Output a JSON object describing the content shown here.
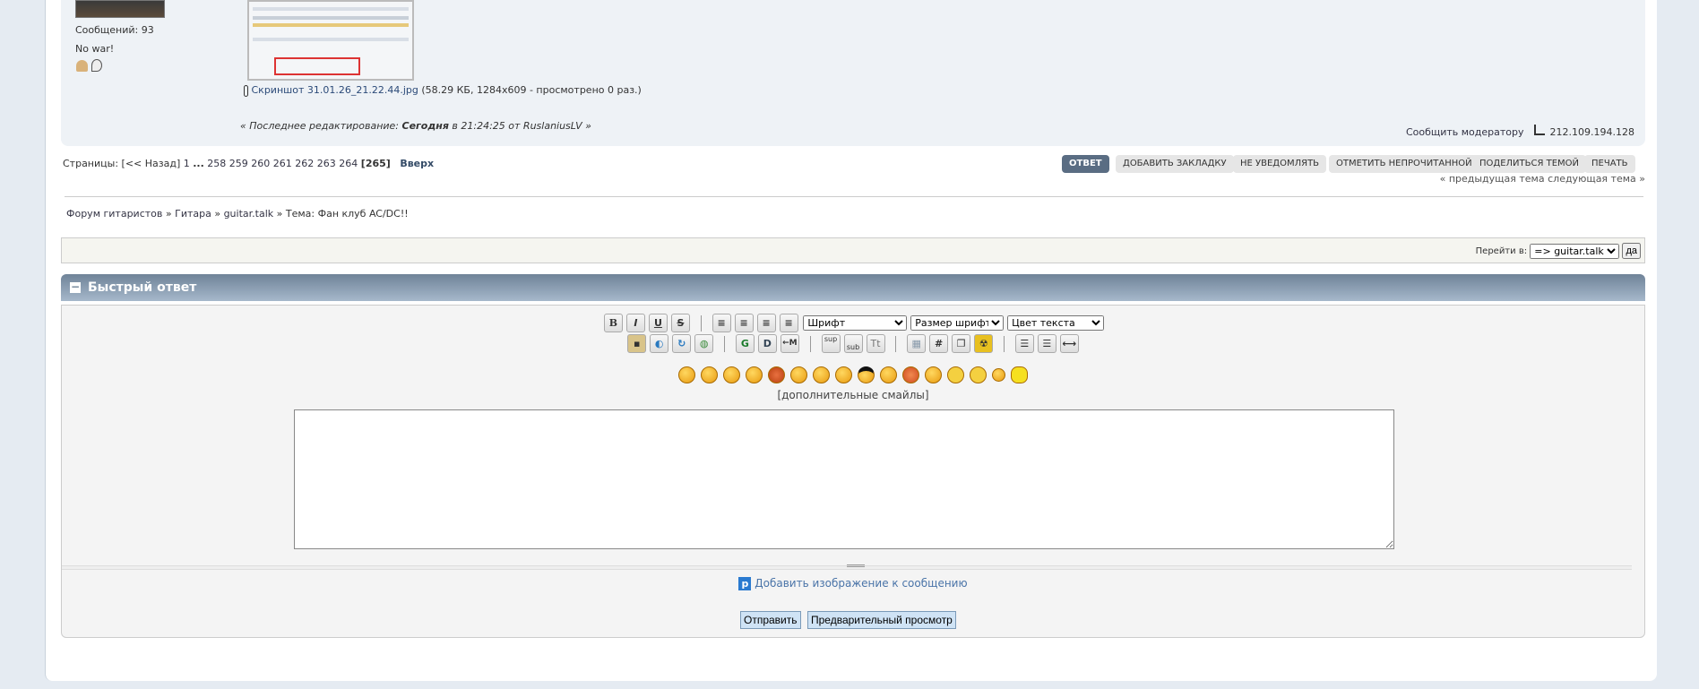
{
  "post": {
    "posts_count": "Сообщений: 93",
    "signature": "No war!",
    "attachment_name": "Скриншот 31.01.26_21.22.44.jpg",
    "attachment_info": "(58.29 КБ, 1284x609 - просмотрено 0 раз.)",
    "edit_prefix": "« Последнее редактирование:",
    "edit_day": "Сегодня",
    "edit_suffix": "в 21:24:25 от RuslaniusLV »",
    "report": "Сообщить модератору",
    "ip": "212.109.194.128"
  },
  "pagination": {
    "label": "Страницы: [<< Назад]",
    "first": "1",
    "dots": "...",
    "pages": [
      "258",
      "259",
      "260",
      "261",
      "262",
      "263",
      "264"
    ],
    "current": "[265]",
    "top": "Вверх"
  },
  "actions": [
    "ОТВЕТ",
    "ДОБАВИТЬ ЗАКЛАДКУ",
    "НЕ УВЕДОМЛЯТЬ",
    "ОТМЕТИТЬ НЕПРОЧИТАННОЙ",
    "ПОДЕЛИТЬСЯ ТЕМОЙ",
    "ПЕЧАТЬ"
  ],
  "topic_nav": {
    "prev": "« предыдущая тема",
    "next": "следующая тема »"
  },
  "breadcrumb": [
    "Форум гитаристов",
    "Гитара",
    "guitar.talk",
    "Тема: Фан клуб AC/DC!!"
  ],
  "breadcrumb_sep": "»",
  "jump": {
    "label": "Перейти в:",
    "selected": "=> guitar.talk",
    "go": "да"
  },
  "quick_reply": {
    "title": "Быстрый ответ",
    "collapse": "−",
    "font": "Шрифт",
    "size": "Размер шрифта",
    "color": "Цвет текста",
    "more_smileys": "[дополнительные смайлы]",
    "add_image": "Добавить изображение к сообщению",
    "send": "Отправить",
    "preview": "Предварительный просмотр",
    "toolbar1": [
      "B",
      "I",
      "U",
      "S"
    ],
    "toolbar_row2": [
      "sup",
      "sub",
      "Tt",
      "#"
    ],
    "textarea": ""
  }
}
